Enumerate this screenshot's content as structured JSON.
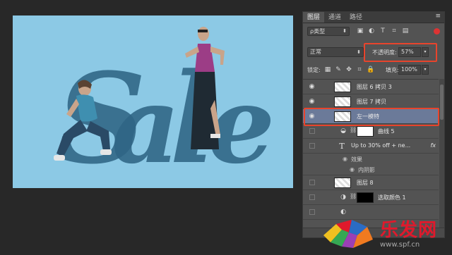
{
  "panel": {
    "tabs": [
      {
        "label": "图层",
        "active": true
      },
      {
        "label": "通道",
        "active": false
      },
      {
        "label": "路径",
        "active": false
      }
    ],
    "menu_icon": "≡",
    "filter_kind": "ρ类型",
    "blend_mode": "正常",
    "opacity_label": "不透明度:",
    "opacity_value": "57%",
    "lock_label": "锁定:",
    "fill_label": "填充:",
    "fill_value": "100%",
    "layers": [
      {
        "name": "图层 6 拷贝 3",
        "visible": true,
        "selected": false
      },
      {
        "name": "图层 7 拷贝",
        "visible": true,
        "selected": false
      },
      {
        "name": "左一模特",
        "visible": true,
        "selected": true
      },
      {
        "name": "曲线 5",
        "visible": false,
        "selected": false
      },
      {
        "name": "Up to 30% off + ne...",
        "visible": false,
        "selected": false,
        "fx": "fx"
      },
      {
        "name": "效果",
        "visible": false,
        "selected": false
      },
      {
        "name": "内阴影",
        "visible": false,
        "selected": false
      },
      {
        "name": "图层 8",
        "visible": false,
        "selected": false
      },
      {
        "name": "选取颜色 1",
        "visible": false,
        "selected": false
      }
    ]
  },
  "colors": {
    "canvas_bg": "#8cc9e5",
    "text_fill": "#2f6585",
    "highlight": "#e8442c",
    "selected_layer": "#6b7a99"
  },
  "watermark": {
    "text": "乐发网",
    "url": "www.spf.cn"
  },
  "icons": [
    "eye-icon",
    "text-layer-icon",
    "fx-icon",
    "chain-link-icon",
    "curves-icon",
    "selective-color-icon",
    "lock-icon",
    "brush-icon",
    "move-icon",
    "artboard-icon"
  ]
}
